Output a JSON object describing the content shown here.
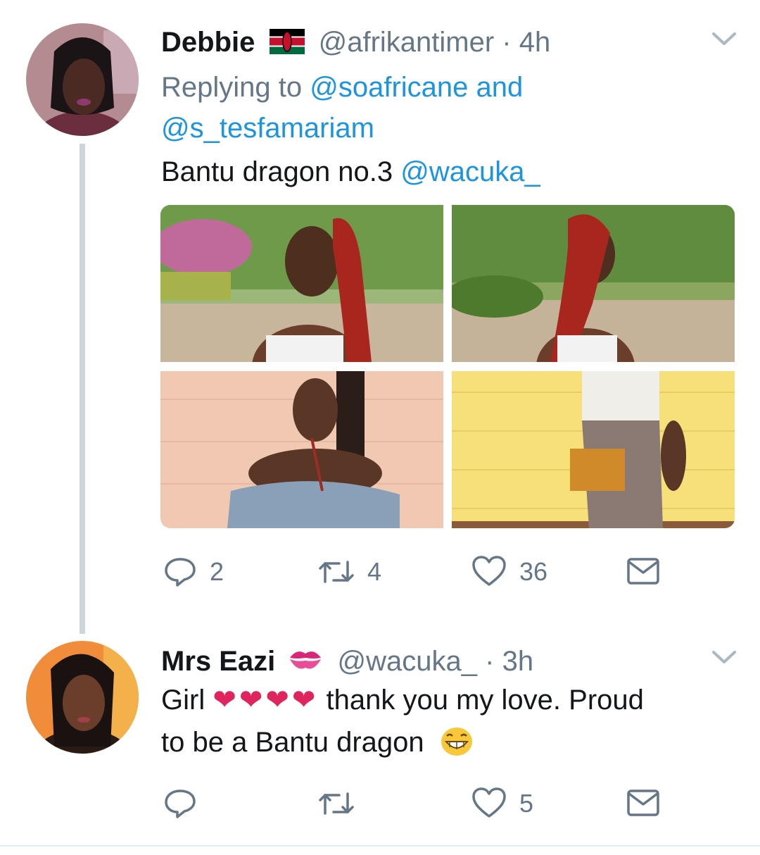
{
  "tweet1": {
    "author_name": "Debbie",
    "author_flag": "kenya-flag-emoji",
    "handle": "@afrikantimer",
    "separator": "·",
    "time": "4h",
    "replying_prefix": "Replying to",
    "replying_user1": "@soafricane",
    "replying_and": "and",
    "replying_user2": "@s_tesfamariam",
    "text": "Bantu dragon no.3",
    "text_mention": "@wacuka_",
    "photos": [
      "photo-1",
      "photo-2",
      "photo-3",
      "photo-4"
    ],
    "actions": {
      "reply_count": "2",
      "retweet_count": "4",
      "like_count": "36"
    }
  },
  "tweet2": {
    "author_name": "Mrs Eazi",
    "author_emoji": "kiss-mark-emoji",
    "handle": "@wacuka_",
    "separator": "·",
    "time": "3h",
    "text_prefix": "Girl",
    "hearts": "❤❤❤❤",
    "text_line1_rest": "thank you my love. Proud",
    "text_line2": "to be a Bantu dragon",
    "text_emoji": "laughing-face-emoji",
    "actions": {
      "reply_count": "",
      "retweet_count": "",
      "like_count": "5"
    }
  },
  "colors": {
    "link": "#1b95e0",
    "muted": "#657786",
    "thread_line": "#ccd6dd",
    "heart": "#e0245e"
  }
}
